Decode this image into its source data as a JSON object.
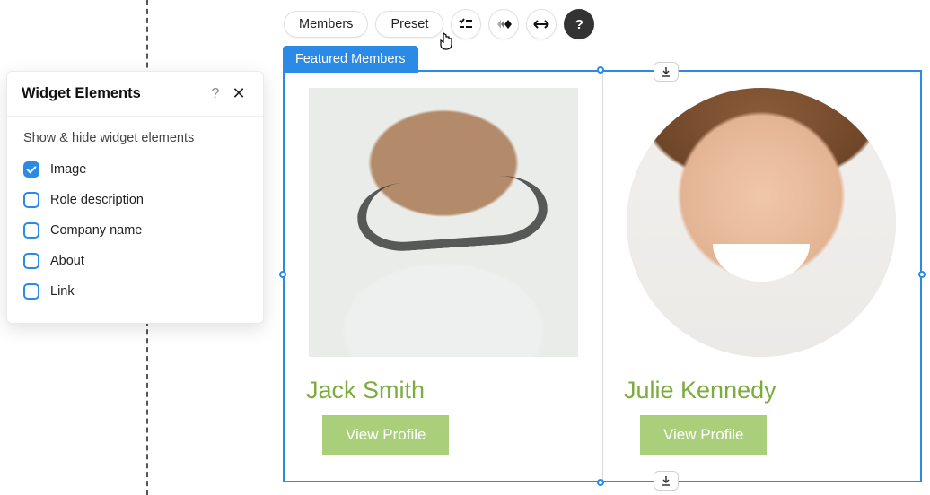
{
  "toolbar": {
    "members_label": "Members",
    "preset_label": "Preset",
    "icon1": "checklist-icon",
    "icon2": "animate-icon",
    "icon3": "stretch-icon",
    "help": "?"
  },
  "widget": {
    "tab_label": "Featured Members",
    "cards": [
      {
        "name": "Jack Smith",
        "button": "View Profile",
        "image_name": "member-photo-jack"
      },
      {
        "name": "Julie Kennedy",
        "button": "View Profile",
        "image_name": "member-photo-julie"
      }
    ]
  },
  "panel": {
    "title": "Widget Elements",
    "subtitle": "Show & hide widget elements",
    "options": [
      {
        "label": "Image",
        "checked": true
      },
      {
        "label": "Role description",
        "checked": false
      },
      {
        "label": "Company name",
        "checked": false
      },
      {
        "label": "About",
        "checked": false
      },
      {
        "label": "Link",
        "checked": false
      }
    ]
  }
}
